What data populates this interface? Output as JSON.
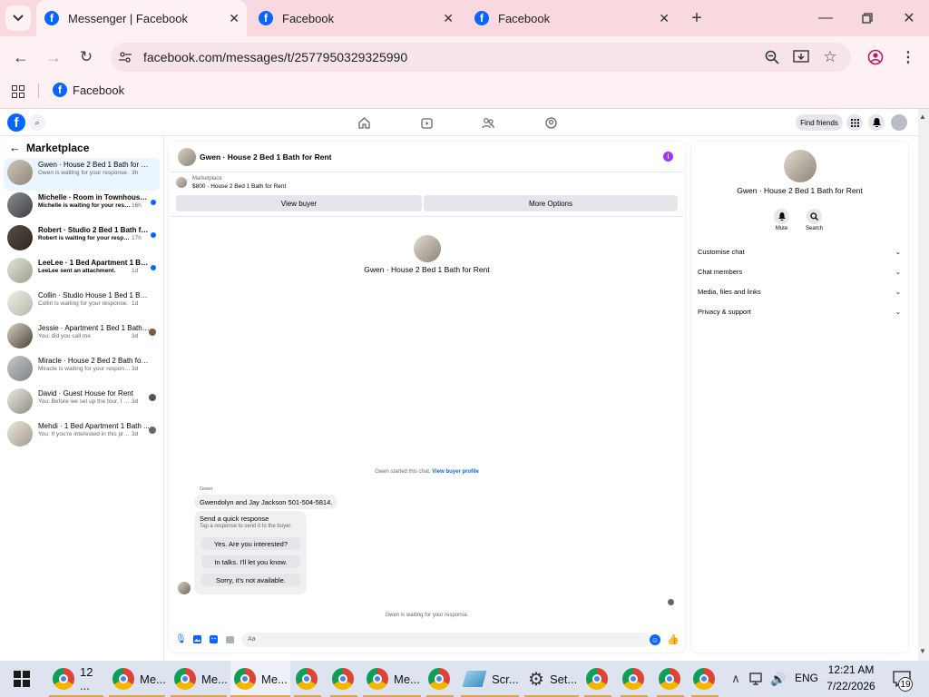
{
  "browser": {
    "tabs": [
      {
        "title": "Messenger | Facebook"
      },
      {
        "title": "Facebook"
      },
      {
        "title": "Facebook"
      }
    ],
    "url": "facebook.com/messages/t/2577950329325990",
    "bookmark": "Facebook"
  },
  "fb": {
    "find_friends": "Find friends"
  },
  "sidebar": {
    "title": "Marketplace",
    "items": [
      {
        "name": "Gwen · House 2 Bed 1 Bath for Rent",
        "snippet": "Gwen is waiting for your response.",
        "time": "3h",
        "unread": false
      },
      {
        "name": "Michelle · Room in Townhouse 1...",
        "snippet": "Michelle is waiting for your response.",
        "time": "16h",
        "unread": true
      },
      {
        "name": "Robert · Studio 2 Bed 1 Bath for ...",
        "snippet": "Robert is waiting for your respon...",
        "time": "17h",
        "unread": true
      },
      {
        "name": "LeeLee · 1 Bed Apartment 1 Bath ...",
        "snippet": "LeeLee sent an attachment.",
        "time": "1d",
        "unread": true
      },
      {
        "name": "Collin · Studio House 1 Bed 1 Bath ...",
        "snippet": "Collin is waiting for your response.",
        "time": "1d",
        "unread": false
      },
      {
        "name": "Jessie · Apartment 1 Bed 1 Bath f...",
        "snippet": "You: did you call me",
        "time": "3d",
        "unread": false
      },
      {
        "name": "Miracle · House 2 Bed 2 Bath for R...",
        "snippet": "Miracle is waiting for your response.",
        "time": "3d",
        "unread": false
      },
      {
        "name": "David · Guest House for Rent",
        "snippet": "You: Before we set up the tour, I ca...",
        "time": "3d",
        "unread": false
      },
      {
        "name": "Mehdi · 1 Bed Apartment 1 Bath ...",
        "snippet": "You: If you're interested in this pro...",
        "time": "3d",
        "unread": false
      }
    ]
  },
  "chat": {
    "title": "Gwen · House 2 Bed 1 Bath for Rent",
    "listing_label": "Marketplace",
    "listing_price": "$800 · House 2 Bed 1 Bath for Rent",
    "view_buyer": "View buyer",
    "more_options": "More Options",
    "center_title": "Gwen · House 2 Bed 1 Bath for Rent",
    "started": "Gwen started this chat.",
    "view_profile": "View buyer profile",
    "sender": "Gwen",
    "message": "Gwendolyn and Jay Jackson 501-504-5814.",
    "quick_title": "Send a quick response",
    "quick_sub": "Tap a response to send it to the buyer.",
    "quick": [
      "Yes. Are you interested?",
      "In talks. I'll let you know.",
      "Sorry, it's not available."
    ],
    "waiting": "Gwen is waiting for your response.",
    "input_placeholder": "Aa"
  },
  "details": {
    "title": "Gwen · House 2 Bed 1 Bath for Rent",
    "mute": "Mute",
    "search": "Search",
    "rows": [
      "Customise chat",
      "Chat members",
      "Media, files and links",
      "Privacy & support"
    ]
  },
  "taskbar": {
    "items": [
      "12 ...",
      "Me...",
      "Me...",
      "Me...",
      "Me...",
      "Scr...",
      "Set..."
    ],
    "lang": "ENG",
    "time": "12:21 AM",
    "date": "7/22/2026",
    "notif": "19"
  }
}
